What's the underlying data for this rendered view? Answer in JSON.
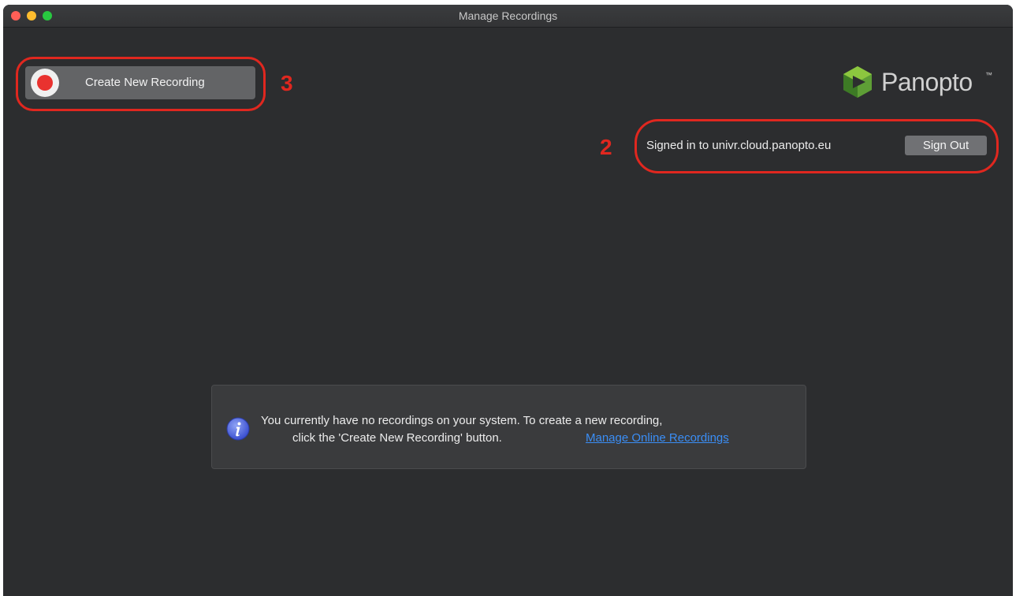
{
  "window": {
    "title": "Manage Recordings"
  },
  "toolbar": {
    "create_label": "Create New Recording"
  },
  "logo": {
    "text": "Panopto",
    "tm": "™"
  },
  "account": {
    "signed_in_text": "Signed in to univr.cloud.panopto.eu",
    "sign_out_label": "Sign Out"
  },
  "info": {
    "line1": "You currently have no recordings on your system. To create a new recording,",
    "line2": "click the 'Create New Recording' button.",
    "link_label": "Manage Online Recordings"
  },
  "annotations": {
    "callout_3": "3",
    "callout_2": "2"
  },
  "colors": {
    "background": "#2c2d2f",
    "accent_red": "#e0271f",
    "link": "#3a8ef6",
    "logo_green": "#6ab23e"
  }
}
